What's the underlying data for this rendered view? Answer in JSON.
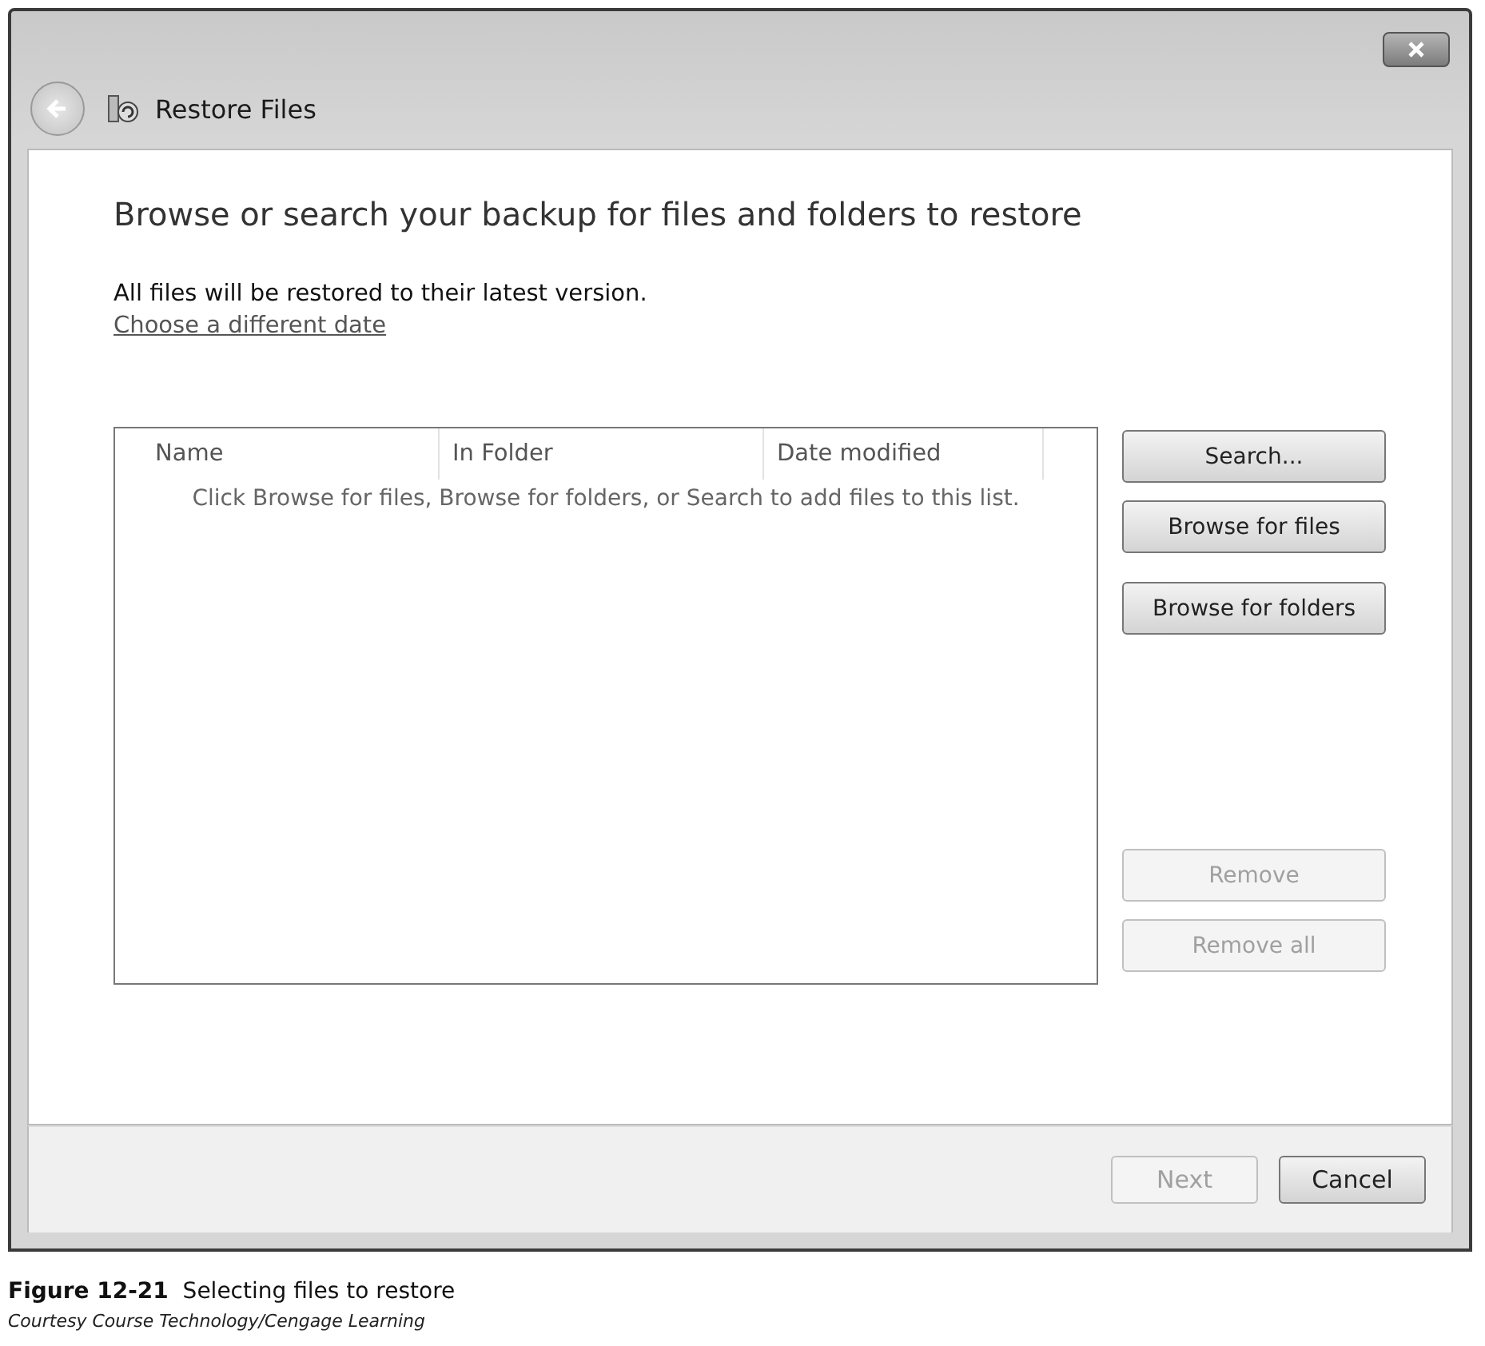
{
  "window": {
    "title": "Restore Files"
  },
  "heading": "Browse or search your backup for files and folders to restore",
  "info": "All files will be restored to their latest version.",
  "date_link": "Choose a different date",
  "list": {
    "columns": [
      "Name",
      "In Folder",
      "Date modified"
    ],
    "empty_text": "Click Browse for files, Browse for folders, or Search to add files to this list."
  },
  "side_buttons": [
    {
      "label": "Search...",
      "disabled": false
    },
    {
      "label": "Browse for files",
      "disabled": false
    },
    {
      "label": "Browse for folders",
      "disabled": false
    },
    {
      "label": "Remove",
      "disabled": true
    },
    {
      "label": "Remove all",
      "disabled": true
    }
  ],
  "footer_buttons": [
    {
      "label": "Next",
      "disabled": true
    },
    {
      "label": "Cancel",
      "disabled": false
    }
  ],
  "caption": {
    "title": "**Figure 12-21**  Selecting files to restore",
    "credit": "Courtesy Course Technology/Cengage Learning"
  }
}
